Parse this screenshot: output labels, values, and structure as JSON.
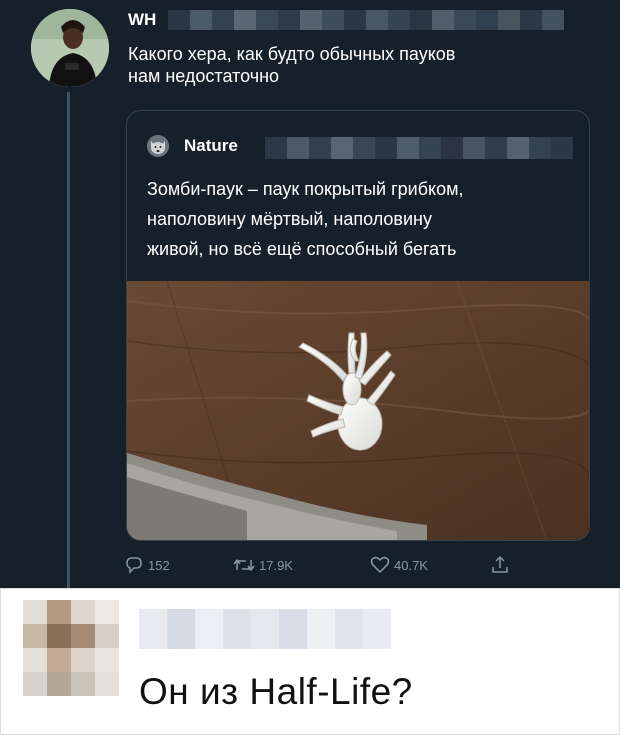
{
  "tweet": {
    "author_name": "WH",
    "text_line1": "Какого хера, как будто обычных пауков",
    "text_line2": "нам недостаточно",
    "quote": {
      "author_name": "Nature",
      "text_line1": "Зомби-паук – паук покрытый грибком,",
      "text_line2": "наполовину мёртвый, наполовину",
      "text_line3": "живой, но всё ещё способный бегать",
      "media_icon": "zombie-spider-photo"
    },
    "actions": {
      "replies": "152",
      "retweets": "17.9K",
      "likes": "40.7K"
    }
  },
  "comment": {
    "text": "Он из Half-Life?"
  },
  "colors": {
    "background": "#15202b",
    "text": "#ffffff",
    "muted": "#8899a6",
    "border": "#38444d"
  }
}
